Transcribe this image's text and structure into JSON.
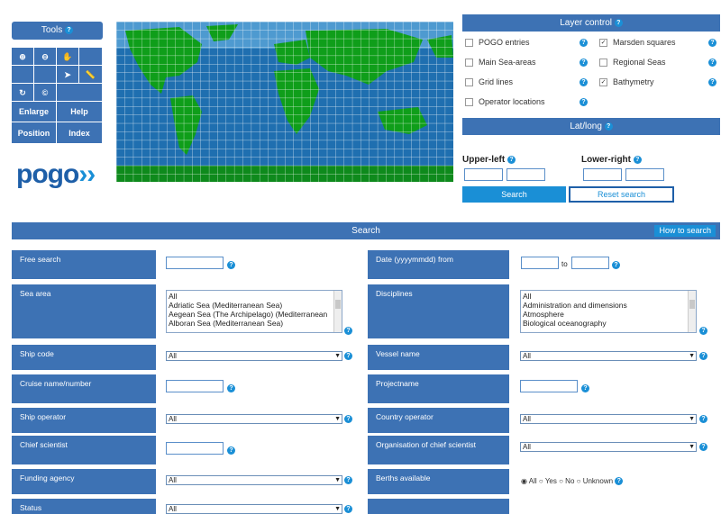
{
  "tools": {
    "title": "Tools",
    "buttons": {
      "enlarge": "Enlarge",
      "help": "Help",
      "position": "Position",
      "index": "Index"
    }
  },
  "logo": {
    "text": "pogo"
  },
  "layer_control": {
    "title": "Layer control",
    "items": [
      {
        "label": "POGO entries",
        "checked": false
      },
      {
        "label": "Marsden squares",
        "checked": true
      },
      {
        "label": "Main Sea-areas",
        "checked": false
      },
      {
        "label": "Regional Seas",
        "checked": false
      },
      {
        "label": "Grid lines",
        "checked": false
      },
      {
        "label": "Bathymetry",
        "checked": true
      },
      {
        "label": "Operator locations",
        "checked": false
      }
    ]
  },
  "latlong": {
    "title": "Lat/long",
    "upper_left": "Upper-left",
    "lower_right": "Lower-right",
    "search_button": "Search",
    "reset_button": "Reset search"
  },
  "search": {
    "title": "Search",
    "how_to": "How to search",
    "fields": {
      "free_search": "Free search",
      "date_from": "Date (yyyymmdd) from",
      "date_to": "to",
      "sea_area": "Sea area",
      "disciplines": "Disciplines",
      "ship_code": "Ship code",
      "vessel_name": "Vessel name",
      "cruise": "Cruise name/number",
      "projectname": "Projectname",
      "ship_operator": "Ship operator",
      "country_operator": "Country operator",
      "chief_scientist": "Chief scientist",
      "org_chief": "Organisation of chief scientist",
      "funding": "Funding agency",
      "berths": "Berths available",
      "status": "Status"
    },
    "sea_area_options": [
      "All",
      "Adriatic Sea (Mediterranean Sea)",
      "Aegean Sea (The Archipelago) (Mediterranean",
      "Alboran Sea (Mediterranean Sea)"
    ],
    "discipline_options": [
      "All",
      "Administration and dimensions",
      "Atmosphere",
      "Biological oceanography"
    ],
    "select_value": "All",
    "berths_options": [
      "All",
      "Yes",
      "No",
      "Unknown"
    ]
  }
}
